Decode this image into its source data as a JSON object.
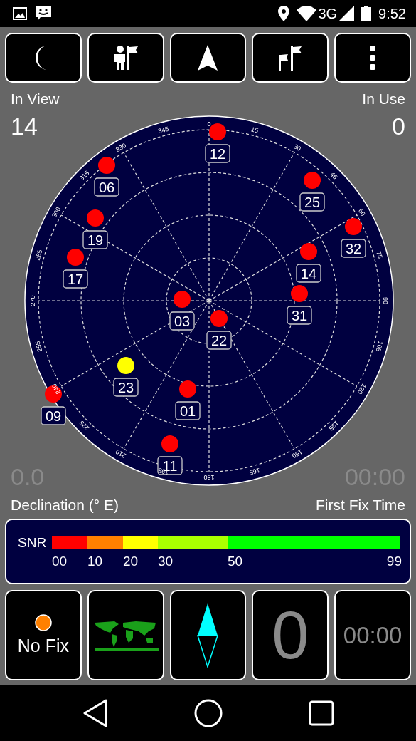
{
  "status_bar": {
    "network": "3G",
    "time": "9:52"
  },
  "sky": {
    "in_view_label": "In View",
    "in_view": "14",
    "in_use_label": "In Use",
    "in_use": "0",
    "bearings": [
      "0",
      "15",
      "30",
      "45",
      "60",
      "75",
      "90",
      "105",
      "120",
      "135",
      "150",
      "165",
      "180",
      "195",
      "210",
      "225",
      "240",
      "255",
      "270",
      "285",
      "300",
      "315",
      "330",
      "345"
    ],
    "satellites": [
      {
        "prn": "12",
        "color": "#ff0000"
      },
      {
        "prn": "06",
        "color": "#ff0000"
      },
      {
        "prn": "25",
        "color": "#ff0000"
      },
      {
        "prn": "19",
        "color": "#ff0000"
      },
      {
        "prn": "32",
        "color": "#ff0000"
      },
      {
        "prn": "17",
        "color": "#ff0000"
      },
      {
        "prn": "14",
        "color": "#ff0000"
      },
      {
        "prn": "31",
        "color": "#ff0000"
      },
      {
        "prn": "03",
        "color": "#ff0000"
      },
      {
        "prn": "22",
        "color": "#ff0000"
      },
      {
        "prn": "23",
        "color": "#ffff00"
      },
      {
        "prn": "01",
        "color": "#ff0000"
      },
      {
        "prn": "09",
        "color": "#ff0000"
      },
      {
        "prn": "11",
        "color": "#ff0000"
      }
    ],
    "declination": "0.0",
    "declination_label": "Declination (° E)",
    "fix_time": "00:00",
    "fix_time_label": "First Fix Time"
  },
  "snr": {
    "title": "SNR",
    "segments": [
      {
        "label": "00",
        "color": "#ff0000"
      },
      {
        "label": "10",
        "color": "#ff8000"
      },
      {
        "label": "20",
        "color": "#ffff00"
      },
      {
        "label": "30",
        "color": "#aaff00"
      },
      {
        "label": "50",
        "color": "#00ff00"
      }
    ],
    "end_label": "99"
  },
  "tiles": [
    {
      "kind": "fix",
      "label": "No Fix",
      "color": "#ff8000"
    },
    {
      "kind": "map"
    },
    {
      "kind": "compass"
    },
    {
      "kind": "count",
      "value": "0"
    },
    {
      "kind": "time",
      "value": "00:00"
    }
  ]
}
